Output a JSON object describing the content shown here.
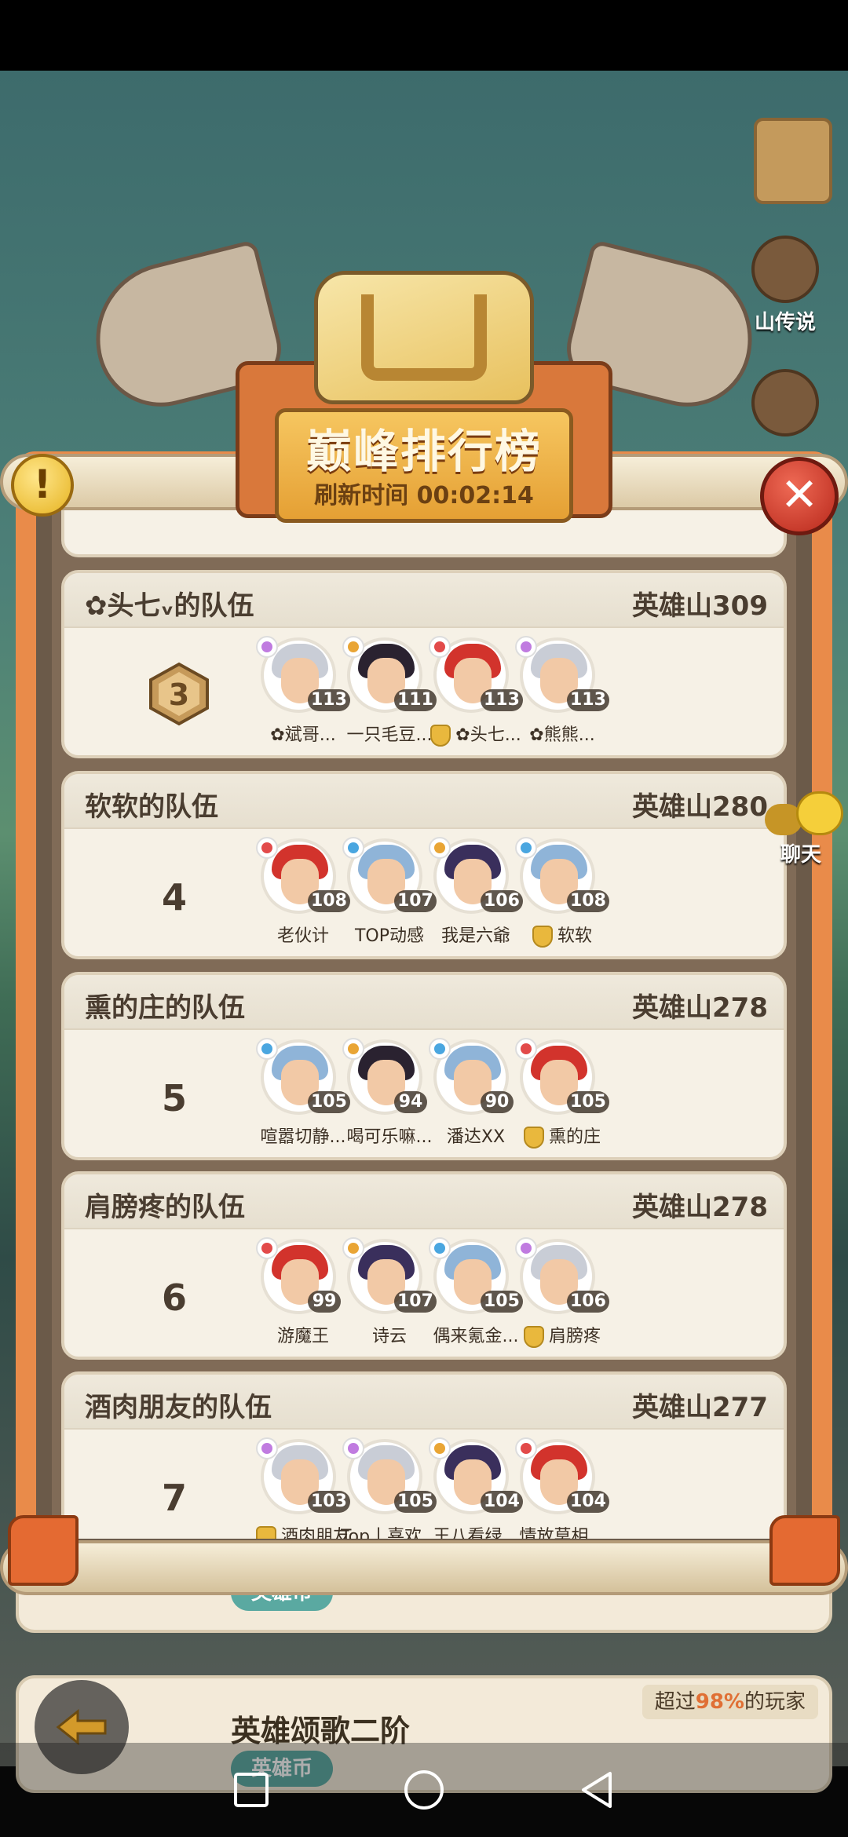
{
  "board": {
    "title": "巅峰排行榜",
    "refresh": "刷新时间 00:02:14"
  },
  "side": {
    "legend_label": "山传说",
    "chat_label": "聊天"
  },
  "bg": {
    "card1_pill": "英雄币",
    "card2_title": "英雄颂歌二阶",
    "card2_pill": "英雄币",
    "card2_note_prefix": "超过",
    "card2_note_pct": "98%",
    "card2_note_suffix": "的玩家"
  },
  "teams": [
    {
      "name": "✿头七ᵥ的队伍",
      "score": "英雄山309",
      "rank": "3",
      "members": [
        {
          "name": "✿斌哥...",
          "level": "113",
          "cls": "#c07be0",
          "hair": "#c9cdd6",
          "leader": false
        },
        {
          "name": "一只毛豆...",
          "level": "111",
          "cls": "#e9a535",
          "hair": "#2a2230",
          "leader": false
        },
        {
          "name": "✿头七...",
          "level": "113",
          "cls": "#e24a4a",
          "hair": "#d2332c",
          "leader": true
        },
        {
          "name": "✿熊熊...",
          "level": "113",
          "cls": "#c07be0",
          "hair": "#c9cdd6",
          "leader": false
        }
      ]
    },
    {
      "name": "软软的队伍",
      "score": "英雄山280",
      "rank": "4",
      "members": [
        {
          "name": "老伙计",
          "level": "108",
          "cls": "#e24a4a",
          "hair": "#d2332c",
          "leader": false
        },
        {
          "name": "TOP动感",
          "level": "107",
          "cls": "#4aa6e0",
          "hair": "#8fb4d8",
          "leader": false
        },
        {
          "name": "我是六爺",
          "level": "106",
          "cls": "#e9a535",
          "hair": "#3a2f5c",
          "leader": false
        },
        {
          "name": "软软",
          "level": "108",
          "cls": "#4aa6e0",
          "hair": "#8fb4d8",
          "leader": true
        }
      ]
    },
    {
      "name": "熏的庄的队伍",
      "score": "英雄山278",
      "rank": "5",
      "members": [
        {
          "name": "喧嚣切静...",
          "level": "105",
          "cls": "#4aa6e0",
          "hair": "#8fb4d8",
          "leader": false
        },
        {
          "name": "喝可乐嘛...",
          "level": "94",
          "cls": "#e9a535",
          "hair": "#2a2230",
          "leader": false
        },
        {
          "name": "潘达XX",
          "level": "90",
          "cls": "#4aa6e0",
          "hair": "#8fb4d8",
          "leader": false
        },
        {
          "name": "熏的庄",
          "level": "105",
          "cls": "#e24a4a",
          "hair": "#d2332c",
          "leader": true
        }
      ]
    },
    {
      "name": "肩膀疼的队伍",
      "score": "英雄山278",
      "rank": "6",
      "members": [
        {
          "name": "游魔王",
          "level": "99",
          "cls": "#e24a4a",
          "hair": "#d2332c",
          "leader": false
        },
        {
          "name": "诗云",
          "level": "107",
          "cls": "#e9a535",
          "hair": "#3a2f5c",
          "leader": false
        },
        {
          "name": "偶来氪金...",
          "level": "105",
          "cls": "#4aa6e0",
          "hair": "#8fb4d8",
          "leader": false
        },
        {
          "name": "肩膀疼",
          "level": "106",
          "cls": "#c07be0",
          "hair": "#c9cdd6",
          "leader": true
        }
      ]
    },
    {
      "name": "酒肉朋友的队伍",
      "score": "英雄山277",
      "rank": "7",
      "members": [
        {
          "name": "酒肉朋友",
          "level": "103",
          "cls": "#c07be0",
          "hair": "#c9cdd6",
          "leader": true
        },
        {
          "name": "Top丨喜欢...",
          "level": "105",
          "cls": "#c07be0",
          "hair": "#c9cdd6",
          "leader": false
        },
        {
          "name": "王八看绿...",
          "level": "104",
          "cls": "#e9a535",
          "hair": "#3a2f5c",
          "leader": false
        },
        {
          "name": "情放莫相...",
          "level": "104",
          "cls": "#e24a4a",
          "hair": "#d2332c",
          "leader": false
        }
      ]
    }
  ]
}
